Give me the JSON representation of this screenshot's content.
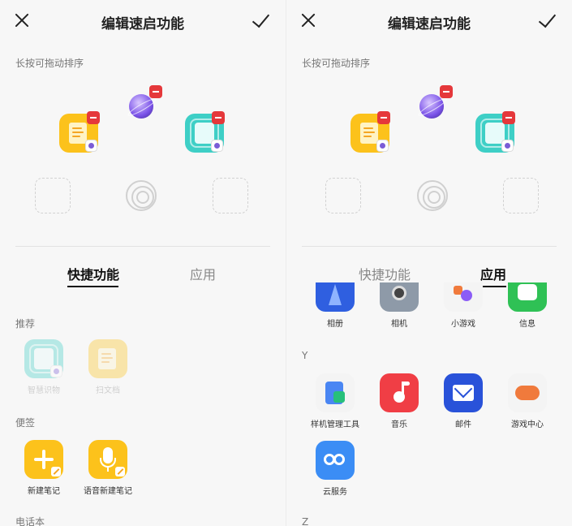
{
  "left_panel": {
    "title": "编辑速启功能",
    "hint": "长按可拖动排序",
    "tabs": [
      {
        "label": "快捷功能",
        "active": true
      },
      {
        "label": "应用",
        "active": false
      }
    ],
    "sections": [
      {
        "label": "推荐",
        "items": [
          {
            "label": "智慧识物",
            "icon": "scan-cube-icon",
            "enabled": false
          },
          {
            "label": "扫文档",
            "icon": "scan-document-icon",
            "enabled": false
          }
        ]
      },
      {
        "label": "便签",
        "items": [
          {
            "label": "新建笔记",
            "icon": "plus-icon"
          },
          {
            "label": "语音新建笔记",
            "icon": "microphone-icon"
          }
        ]
      },
      {
        "label": "电话本",
        "items": []
      }
    ]
  },
  "right_panel": {
    "title": "编辑速启功能",
    "hint": "长按可拖动排序",
    "tabs": [
      {
        "label": "快捷功能",
        "active": false
      },
      {
        "label": "应用",
        "active": true
      }
    ],
    "top_row": [
      {
        "label": "相册",
        "icon": "photos-icon"
      },
      {
        "label": "相机",
        "icon": "camera-icon"
      },
      {
        "label": "小游戏",
        "icon": "mini-games-icon"
      },
      {
        "label": "信息",
        "icon": "messages-icon"
      }
    ],
    "sections": [
      {
        "label": "Y",
        "items": [
          {
            "label": "样机管理工具",
            "icon": "device-tool-icon"
          },
          {
            "label": "音乐",
            "icon": "music-icon"
          },
          {
            "label": "邮件",
            "icon": "mail-icon"
          },
          {
            "label": "游戏中心",
            "icon": "game-center-icon"
          },
          {
            "label": "云服务",
            "icon": "cloud-service-icon"
          }
        ]
      },
      {
        "label": "Z",
        "items": []
      }
    ]
  },
  "colors": {
    "accent_yellow": "#fcc21b",
    "accent_teal": "#3ecfc6",
    "remove_red": "#e5383b",
    "music_red": "#f03e45",
    "mail_blue": "#2952d9",
    "cloud_blue": "#3b8df5"
  }
}
